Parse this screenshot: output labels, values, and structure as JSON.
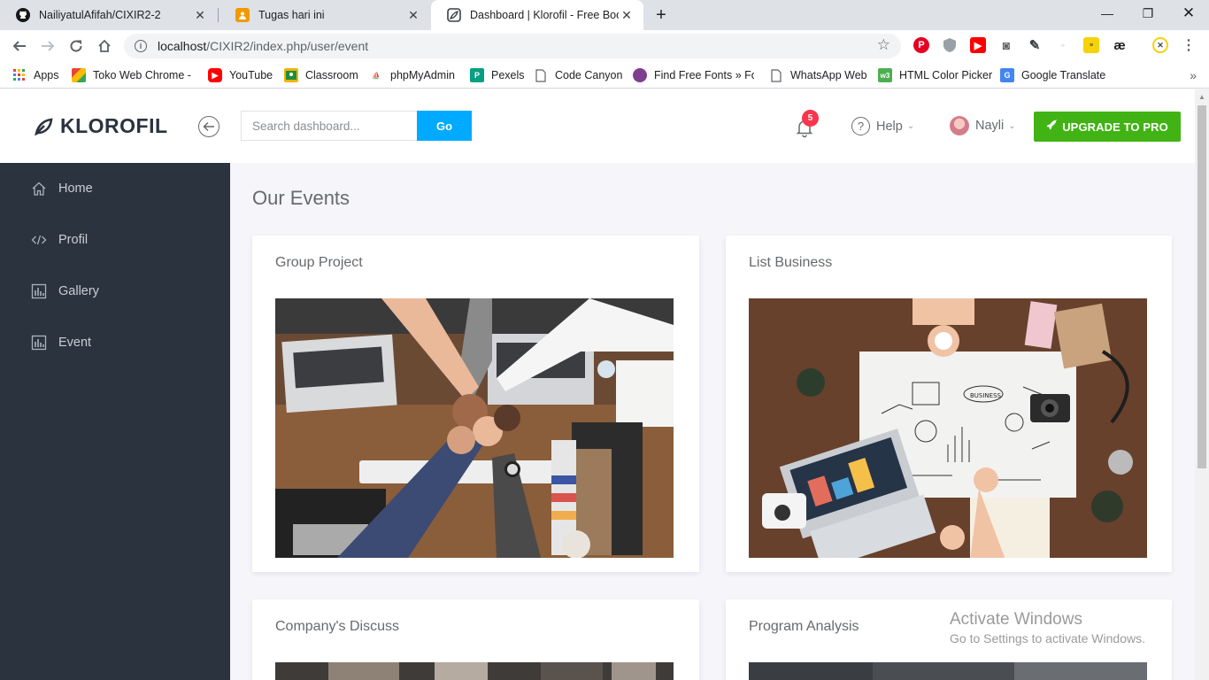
{
  "browser": {
    "tabs": [
      {
        "title": "NailiyatulAfifah/CIXIR2-2",
        "icon": "github-icon"
      },
      {
        "title": "Tugas hari ini",
        "icon": "classroom-icon"
      },
      {
        "title": "Dashboard | Klorofil - Free Bootst",
        "icon": "klorofil-icon"
      }
    ],
    "new_tab_label": "+",
    "url_host": "localhost",
    "url_path": "/CIXIR2/index.php/user/event",
    "bookmarks": [
      {
        "label": "Apps",
        "icon": "apps-grid-icon"
      },
      {
        "label": "Toko Web Chrome - c",
        "icon": "chrome-store-icon"
      },
      {
        "label": "YouTube",
        "icon": "youtube-icon"
      },
      {
        "label": "Classroom",
        "icon": "classroom-icon"
      },
      {
        "label": "phpMyAdmin",
        "icon": "phpmyadmin-icon"
      },
      {
        "label": "Pexels",
        "icon": "pexels-icon"
      },
      {
        "label": "Code Canyon",
        "icon": "page-icon"
      },
      {
        "label": "Find Free Fonts » For",
        "icon": "fonts-icon"
      },
      {
        "label": "WhatsApp Web",
        "icon": "page-icon"
      },
      {
        "label": "HTML Color Picker",
        "icon": "w3schools-icon"
      },
      {
        "label": "Google Translate",
        "icon": "translate-icon"
      }
    ]
  },
  "header": {
    "brand": "KLOROFIL",
    "search_placeholder": "Search dashboard...",
    "search_button": "Go",
    "notification_count": "5",
    "help_label": "Help",
    "user_name": "Nayli",
    "upgrade_label": "UPGRADE TO PRO"
  },
  "sidebar": {
    "items": [
      {
        "label": "Home",
        "icon": "home-icon"
      },
      {
        "label": "Profil",
        "icon": "code-icon"
      },
      {
        "label": "Gallery",
        "icon": "bar-chart-icon"
      },
      {
        "label": "Event",
        "icon": "bar-chart-icon"
      }
    ]
  },
  "main": {
    "title": "Our Events",
    "events": [
      {
        "title": "Group Project"
      },
      {
        "title": "List Business"
      },
      {
        "title": "Company's Discuss"
      },
      {
        "title": "Program Analysis"
      }
    ]
  },
  "watermark": {
    "line1": "Activate Windows",
    "line2": "Go to Settings to activate Windows."
  },
  "colors": {
    "sidebar_bg": "#2b333e",
    "go_button": "#00aaff",
    "upgrade_button": "#41b314",
    "badge": "#f9354c"
  }
}
